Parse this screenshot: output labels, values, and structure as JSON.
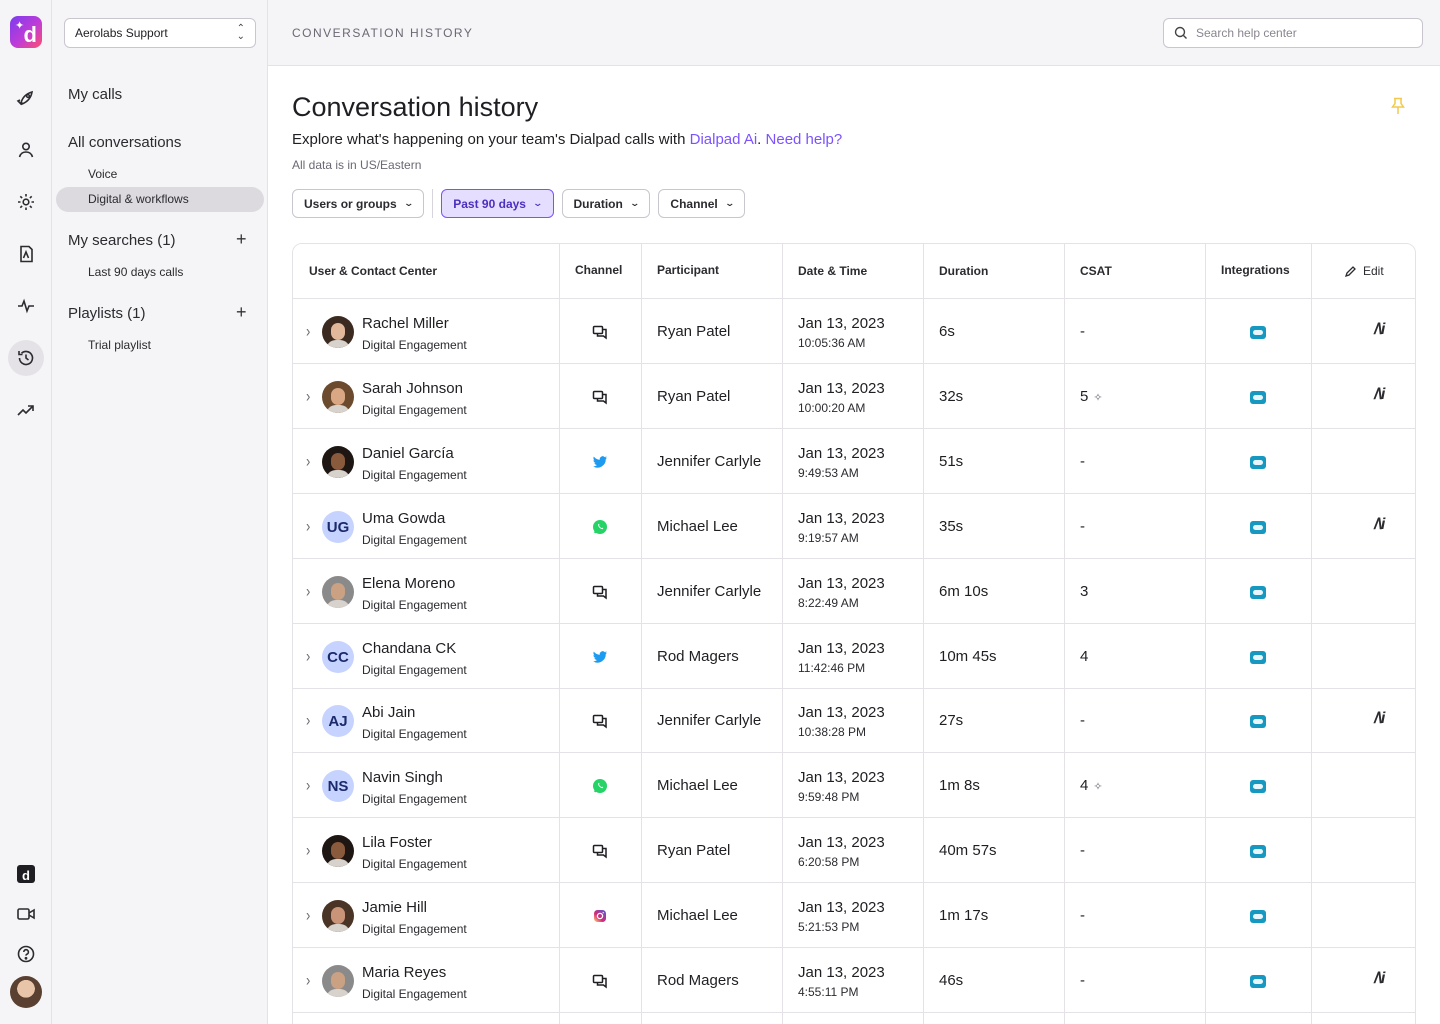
{
  "app": {
    "workspace": "Aerolabs Support",
    "breadcrumb": "CONVERSATION HISTORY",
    "search_placeholder": "Search help center"
  },
  "rail": {
    "icons": [
      "rocket-icon",
      "person-icon",
      "gear-icon",
      "analytics-icon",
      "pulse-icon",
      "history-icon",
      "trending-icon",
      "dialpad-icon",
      "video-icon",
      "help-icon"
    ],
    "active": "history-icon"
  },
  "nav": {
    "my_calls": "My calls",
    "all_conversations": "All conversations",
    "voice": "Voice",
    "digital": "Digital & workflows",
    "my_searches": "My searches (1)",
    "last90": "Last 90 days calls",
    "playlists": "Playlists (1)",
    "trial_playlist": "Trial playlist"
  },
  "page": {
    "title": "Conversation history",
    "subtitle_prefix": "Explore what's happening on your team's Dialpad calls with ",
    "subtitle_link1": "Dialpad Ai",
    "subtitle_sep": ". ",
    "subtitle_link2": "Need help?",
    "timezone_note": "All data is in US/Eastern"
  },
  "filters": {
    "users": "Users or groups",
    "date": "Past 90 days",
    "duration": "Duration",
    "channel": "Channel"
  },
  "table": {
    "headers": {
      "user": "User & Contact Center",
      "channel": "Channel",
      "participant": "Participant",
      "datetime": "Date & Time",
      "duration": "Duration",
      "csat": "CSAT",
      "integrations": "Integrations",
      "edit": "Edit"
    },
    "rows": [
      {
        "name": "Rachel Miller",
        "team": "Digital Engagement",
        "avatar": "photo",
        "initials": "",
        "channel": "chat",
        "participant": "Ryan Patel",
        "date": "Jan 13, 2023",
        "time": "10:05:36 AM",
        "duration": "6s",
        "csat": "-",
        "csat_ai": false,
        "ai": true
      },
      {
        "name": "Sarah Johnson",
        "team": "Digital Engagement",
        "avatar": "photo",
        "initials": "",
        "channel": "chat",
        "participant": "Ryan Patel",
        "date": "Jan 13, 2023",
        "time": "10:00:20 AM",
        "duration": "32s",
        "csat": "5",
        "csat_ai": true,
        "ai": true
      },
      {
        "name": "Daniel García",
        "team": "Digital Engagement",
        "avatar": "photo",
        "initials": "",
        "channel": "twitter",
        "participant": "Jennifer Carlyle",
        "date": "Jan 13, 2023",
        "time": "9:49:53 AM",
        "duration": "51s",
        "csat": "-",
        "csat_ai": false,
        "ai": false
      },
      {
        "name": "Uma Gowda",
        "team": "Digital Engagement",
        "avatar": "initials",
        "initials": "UG",
        "channel": "whatsapp",
        "participant": "Michael Lee",
        "date": "Jan 13, 2023",
        "time": "9:19:57 AM",
        "duration": "35s",
        "csat": "-",
        "csat_ai": false,
        "ai": true
      },
      {
        "name": "Elena Moreno",
        "team": "Digital Engagement",
        "avatar": "photo",
        "initials": "",
        "channel": "chat",
        "participant": "Jennifer Carlyle",
        "date": "Jan 13, 2023",
        "time": "8:22:49 AM",
        "duration": "6m 10s",
        "csat": "3",
        "csat_ai": false,
        "ai": false
      },
      {
        "name": "Chandana CK",
        "team": "Digital Engagement",
        "avatar": "initials",
        "initials": "CC",
        "channel": "twitter",
        "participant": "Rod Magers",
        "date": "Jan 13, 2023",
        "time": "11:42:46 PM",
        "duration": "10m 45s",
        "csat": "4",
        "csat_ai": false,
        "ai": false
      },
      {
        "name": "Abi Jain",
        "team": "Digital Engagement",
        "avatar": "initials",
        "initials": "AJ",
        "channel": "chat",
        "participant": "Jennifer Carlyle",
        "date": "Jan 13, 2023",
        "time": "10:38:28 PM",
        "duration": "27s",
        "csat": "-",
        "csat_ai": false,
        "ai": true
      },
      {
        "name": "Navin Singh",
        "team": "Digital Engagement",
        "avatar": "initials",
        "initials": "NS",
        "channel": "whatsapp",
        "participant": "Michael Lee",
        "date": "Jan 13, 2023",
        "time": "9:59:48 PM",
        "duration": "1m 8s",
        "csat": "4",
        "csat_ai": true,
        "ai": false
      },
      {
        "name": "Lila Foster",
        "team": "Digital Engagement",
        "avatar": "photo",
        "initials": "",
        "channel": "chat",
        "participant": "Ryan Patel",
        "date": "Jan 13, 2023",
        "time": "6:20:58 PM",
        "duration": "40m 57s",
        "csat": "-",
        "csat_ai": false,
        "ai": false
      },
      {
        "name": "Jamie Hill",
        "team": "Digital Engagement",
        "avatar": "photo",
        "initials": "",
        "channel": "instagram",
        "participant": "Michael Lee",
        "date": "Jan 13, 2023",
        "time": "5:21:53 PM",
        "duration": "1m 17s",
        "csat": "-",
        "csat_ai": false,
        "ai": false
      },
      {
        "name": "Maria Reyes",
        "team": "Digital Engagement",
        "avatar": "photo",
        "initials": "",
        "channel": "chat",
        "participant": "Rod Magers",
        "date": "Jan 13, 2023",
        "time": "4:55:11 PM",
        "duration": "46s",
        "csat": "-",
        "csat_ai": false,
        "ai": true
      }
    ]
  },
  "colors": {
    "accent": "#7c52ff",
    "salesforce": "#1798c1",
    "twitter": "#1d9bf0",
    "whatsapp": "#25d366",
    "pin": "#f2c94c"
  }
}
